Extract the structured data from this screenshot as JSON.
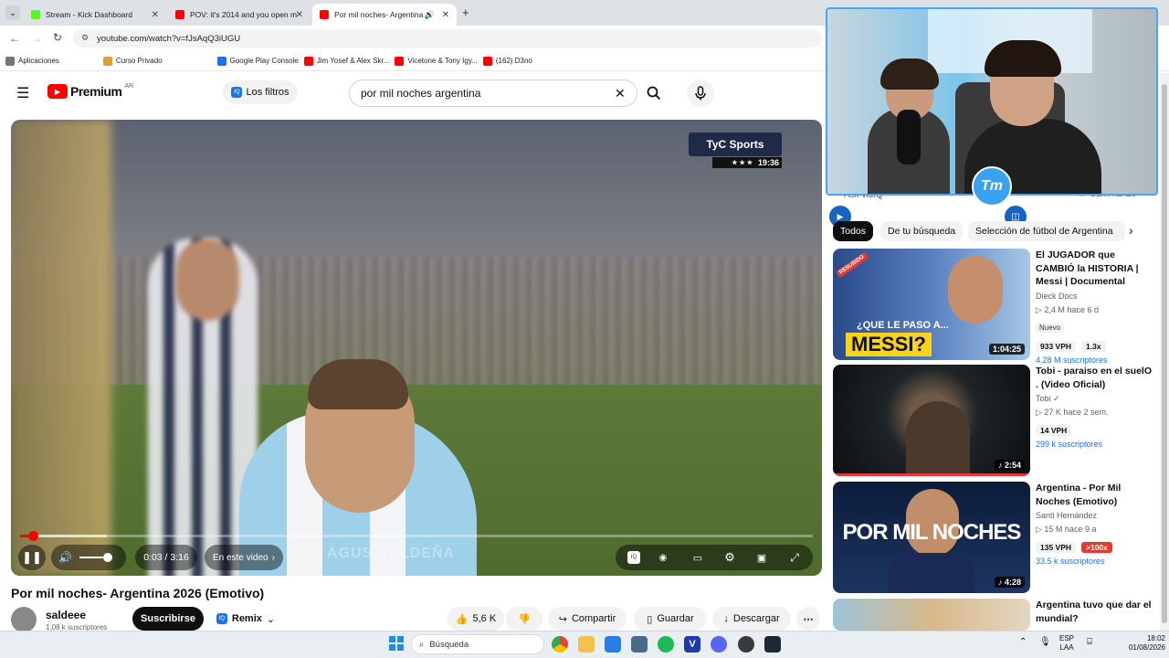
{
  "browser": {
    "tabs": [
      {
        "title": "Stream - Kick Dashboard",
        "color": "#53fc18"
      },
      {
        "title": "POV: it's 2014 and you open m",
        "color": "#ff0000"
      },
      {
        "title": "Por mil noches- Argentina",
        "color": "#ff0000"
      }
    ],
    "url": "youtube.com/watch?v=fJsAqQ3iUGU",
    "bookmarks": [
      "Aplicaciones",
      "Curso Privado",
      "Google Play Console",
      "Jim Yosef & Alex Skr...",
      "Vicetone & Tony Igy...",
      "(162) D3no"
    ]
  },
  "youtube": {
    "logo": "Premium",
    "region": "AR",
    "filter_button": "Los filtros",
    "search_query": "por mil noches argentina"
  },
  "player": {
    "channel_overlay": "TyC Sports",
    "overlay_time": "19:36",
    "time": "0:03 / 3:16",
    "chapter": "En este video",
    "watermark": "AGUS SALDEÑA",
    "progress_fraction": 0.016,
    "buffer_fraction": 0.11,
    "volume_fraction": 0.85
  },
  "video": {
    "title": "Por mil noches- Argentina 2026 (Emotivo)",
    "channel": "saldeee",
    "subscribers": "1,08 k suscriptores",
    "subscribe": "Suscribirse",
    "remix": "Remix",
    "likes": "5,6 K",
    "share": "Compartir",
    "save": "Guardar",
    "download": "Descargar"
  },
  "sidebar": {
    "ask_label": "Ask vidIQ",
    "summarize_label": "Summarize",
    "chips": [
      "Todos",
      "De tu búsqueda",
      "Selección de fútbol de Argentina"
    ],
    "recommendations": [
      {
        "title": "El JUGADOR que CAMBIÓ la HISTORIA | Messi | Documental",
        "channel": "Dieck Docs",
        "meta": "2,4 M   hace 6 d",
        "badge": "Nuevo",
        "vph": "933 VPH",
        "mult": "1.3x",
        "subs": "4.28 M suscriptores",
        "duration": "1:04:25",
        "thumb_text": "¿QUE LE PASO A...",
        "thumb_big": "MESSI?",
        "thumb_tag": "RESUBIDO"
      },
      {
        "title": "Tobi - paraiso en el suelO . (Video Oficial)",
        "channel": "Tobi",
        "meta": "27 K   hace 2 sem.",
        "badge": "",
        "vph": "14 VPH",
        "mult": "",
        "subs": "299 k suscriptores",
        "duration": "2:54"
      },
      {
        "title": "Argentina - Por Mil Noches (Emotivo)",
        "channel": "Santi Hernández",
        "meta": "15 M   hace 9 a",
        "badge": "",
        "vph": "135 VPH",
        "mult": ">100x",
        "subs": "33.5 k suscriptores",
        "duration": "4:28",
        "thumb_big": "POR MIL NOCHES"
      },
      {
        "title": "Argentina tuvo que dar el mundial?",
        "channel": "",
        "meta": "",
        "badge": "",
        "vph": "",
        "mult": "",
        "subs": "",
        "duration": ""
      }
    ]
  },
  "webcam": {
    "logo": "Tm"
  },
  "taskbar": {
    "search": "Búsqueda",
    "lang": "ESP",
    "lang2": "LAA",
    "time": "18:02",
    "date": "01/08/2026"
  }
}
